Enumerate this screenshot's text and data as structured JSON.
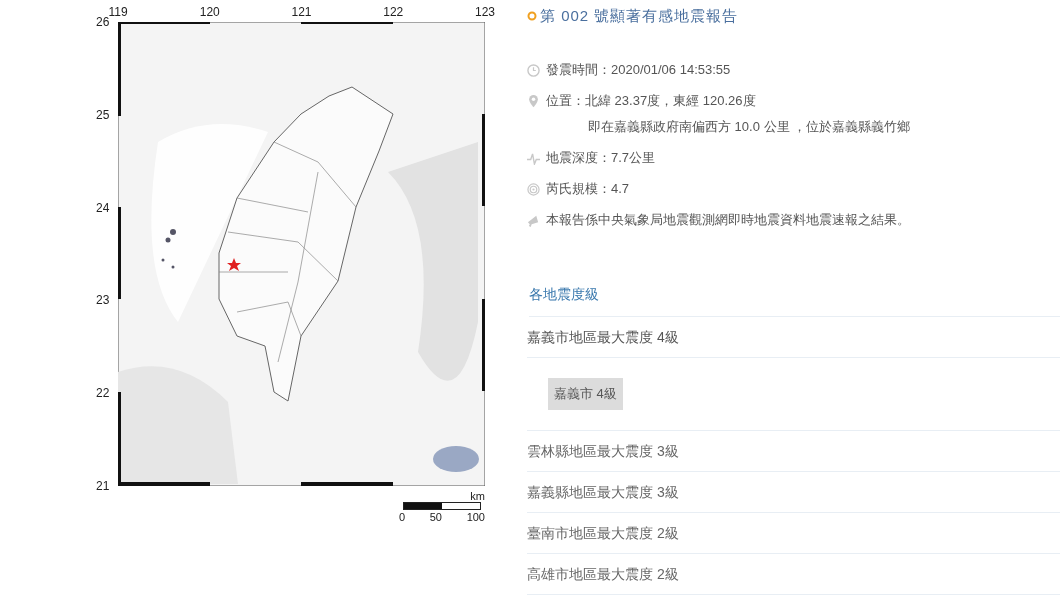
{
  "map": {
    "x_ticks": [
      "119",
      "120",
      "121",
      "122",
      "123"
    ],
    "y_ticks": [
      "26",
      "25",
      "24",
      "23",
      "22",
      "21"
    ],
    "scale": {
      "unit": "km",
      "labels": [
        "0",
        "50",
        "100"
      ]
    }
  },
  "report": {
    "title": "第 002 號顯著有感地震報告",
    "items": [
      {
        "kind": "clock",
        "lines": [
          "發震時間：2020/01/06 14:53:55"
        ]
      },
      {
        "kind": "pin",
        "lines": [
          "位置：北緯 23.37度，東經 120.26度",
          "即在嘉義縣政府南偏西方 10.0 公里 ，位於嘉義縣義竹鄉"
        ]
      },
      {
        "kind": "depth",
        "lines": [
          "地震深度：7.7公里"
        ]
      },
      {
        "kind": "magnitude",
        "lines": [
          "芮氏規模：4.7"
        ]
      },
      {
        "kind": "note",
        "lines": [
          "本報告係中央氣象局地震觀測網即時地震資料地震速報之結果。"
        ]
      }
    ]
  },
  "intensity": {
    "heading": "各地震度級",
    "regions": [
      {
        "title": "嘉義市地區最大震度 4級",
        "expanded": true,
        "stations": [
          "嘉義市 4級"
        ]
      },
      {
        "title": "雲林縣地區最大震度 3級",
        "expanded": false
      },
      {
        "title": "嘉義縣地區最大震度 3級",
        "expanded": false
      },
      {
        "title": "臺南市地區最大震度 2級",
        "expanded": false
      },
      {
        "title": "高雄市地區最大震度 2級",
        "expanded": false
      }
    ]
  }
}
